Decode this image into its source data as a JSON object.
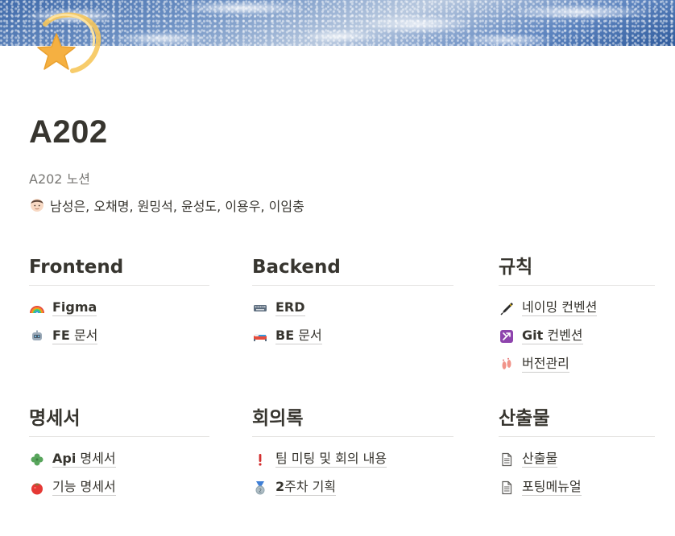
{
  "page": {
    "title": "A202",
    "subtitle": "A202 노션",
    "members": "남성은, 오채명, 원밍석, 윤성도, 이용우, 이임충"
  },
  "sections": {
    "frontend": {
      "heading": "Frontend",
      "items": [
        {
          "icon": "rainbow-icon",
          "label": "Figma"
        },
        {
          "icon": "robot-icon",
          "label_bold": "FE",
          "label": "문서"
        }
      ]
    },
    "backend": {
      "heading": "Backend",
      "items": [
        {
          "icon": "keyboard-icon",
          "label": "ERD"
        },
        {
          "icon": "bed-icon",
          "label_bold": "BE",
          "label": "문서"
        }
      ]
    },
    "rules": {
      "heading": "규칙",
      "items": [
        {
          "icon": "pen-icon",
          "label": "네이밍 컨벤션"
        },
        {
          "icon": "merge-icon",
          "label_bold": "Git",
          "label": "컨벤션"
        },
        {
          "icon": "footprints-icon",
          "label": "버전관리"
        }
      ]
    },
    "spec": {
      "heading": "명세서",
      "items": [
        {
          "icon": "clover-icon",
          "label_bold": "Api",
          "label": "명세서"
        },
        {
          "icon": "tomato-icon",
          "label": "기능 명세서"
        }
      ]
    },
    "minutes": {
      "heading": "회의록",
      "items": [
        {
          "icon": "exclamation-icon",
          "label": "팀 미팅 및 회의 내용"
        },
        {
          "icon": "medal-icon",
          "label_bold": "2",
          "label": "주차 기획"
        }
      ]
    },
    "deliverables": {
      "heading": "산출물",
      "items": [
        {
          "icon": "document-icon",
          "label": "산출물"
        },
        {
          "icon": "document-icon",
          "label": "포팅메뉴얼"
        }
      ]
    }
  }
}
